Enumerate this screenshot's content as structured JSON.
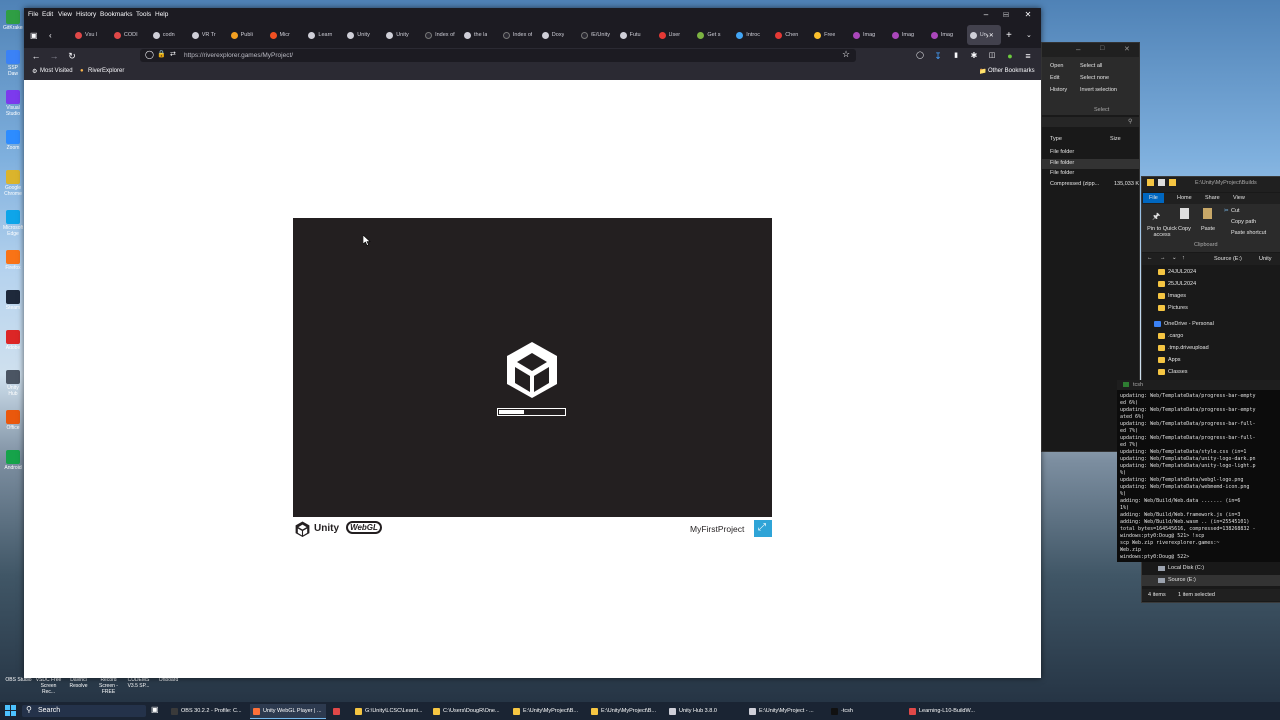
{
  "desktop": {
    "icons": [
      "GitKraken",
      "SSP Daw",
      "Visual Studio",
      "Zoom",
      "Google Chrome",
      "Microsoft Edge",
      "Firefox",
      "Steam",
      "Adobe",
      "Unity Hub",
      "Office",
      "Android"
    ],
    "shortcut_labels": [
      "OBS Studio",
      "VSDC Free Screen Rec...",
      "Davinci Resolve",
      "Record Screen - FREE",
      "CUDEMS V3.5 SP...",
      "Onboard"
    ]
  },
  "browser": {
    "menu": [
      "File",
      "Edit",
      "View",
      "History",
      "Bookmarks",
      "Tools",
      "Help"
    ],
    "tabs": [
      {
        "label": "Vsu l",
        "color": "#e04848"
      },
      {
        "label": "CODI",
        "color": "#e04848"
      },
      {
        "label": "codn",
        "color": "#cfcfd8"
      },
      {
        "label": "VR Tr",
        "color": "#cfcfd8"
      },
      {
        "label": "Publi",
        "color": "#f3a021"
      },
      {
        "label": "Micr",
        "color": "#f25022"
      },
      {
        "label": "Learn",
        "color": "#cfcfd8"
      },
      {
        "label": "Unity",
        "color": "#cfcfd8"
      },
      {
        "label": "Unity",
        "color": "#cfcfd8"
      },
      {
        "label": "Index of",
        "color": "#2b2a33"
      },
      {
        "label": "the la",
        "color": "#cfcfd8"
      },
      {
        "label": "Index of",
        "color": "#2b2a33"
      },
      {
        "label": "Doxy",
        "color": "#cfcfd8"
      },
      {
        "label": "/E/Unity",
        "color": "#2b2a33"
      },
      {
        "label": "Futu",
        "color": "#cfcfd8"
      },
      {
        "label": "User",
        "color": "#e53935"
      },
      {
        "label": "Get s",
        "color": "#7cb342"
      },
      {
        "label": "Introc",
        "color": "#42a5f5"
      },
      {
        "label": "Chen",
        "color": "#e53935"
      },
      {
        "label": "Free",
        "color": "#fbc02d"
      },
      {
        "label": "Imag",
        "color": "#ab47bc"
      },
      {
        "label": "Imag",
        "color": "#ab47bc"
      },
      {
        "label": "Imag",
        "color": "#ab47bc"
      },
      {
        "label": "Un",
        "color": "#cfcfd8",
        "active": true
      }
    ],
    "url": "https://riverexplorer.games/MyProject/",
    "bookmarks": [
      "Most Visited",
      "RiverExplorer"
    ],
    "other_bookmarks": "Other Bookmarks"
  },
  "unity_page": {
    "loading_progress": 0.38,
    "footer_brand_unity": "Unity",
    "footer_brand_webgl": "WebGL",
    "project_title": "MyFirstProject",
    "colors": {
      "canvas_bg": "#231f20",
      "fullscreen_button": "#2fa4d7"
    }
  },
  "explorer_main": {
    "ribbon": [
      "Open",
      "Edit",
      "History",
      "Select all",
      "Select none",
      "Invert selection"
    ],
    "ribbon_group": "Select",
    "columns": [
      "Type",
      "Size"
    ],
    "rows": [
      {
        "type": "File folder",
        "size": ""
      },
      {
        "type": "File folder",
        "size": ""
      },
      {
        "type": "File folder",
        "size": ""
      },
      {
        "type": "Compressed (zipp...",
        "size": "135,033 K"
      }
    ]
  },
  "explorer_builds": {
    "title": "E:\\Unity\\MyProject\\Builds",
    "ribbon_tabs": [
      "File",
      "Home",
      "Share",
      "View"
    ],
    "clipboard_buttons": [
      "Pin to Quick access",
      "Copy",
      "Paste"
    ],
    "clipboard_small": [
      "Cut",
      "Copy path",
      "Paste shortcut"
    ],
    "clipboard_group": "Clipboard",
    "path": [
      "Source (E:)",
      "Unity"
    ],
    "tree": [
      "24JUL2024",
      "25JUL2024",
      "Images",
      "Pictures",
      "OneDrive - Personal",
      ".cargo",
      ".tmp.driveupload",
      "Apps",
      "Classes"
    ],
    "drives": [
      "Local Disk (C:)",
      "Source (E:)"
    ],
    "status": [
      "4 items",
      "1 item selected"
    ]
  },
  "terminal": {
    "title": "tcsh",
    "lines": [
      "updating: Web/TemplateData/progress-bar-empty",
      "ed 6%)",
      "updating: Web/TemplateData/progress-bar-empty",
      "ated 6%)",
      "updating: Web/TemplateData/progress-bar-full-",
      "ed 7%)",
      "updating: Web/TemplateData/progress-bar-full-",
      "ed 7%)",
      "updating: Web/TemplateData/style.css    (in=1",
      "updating: Web/TemplateData/unity-logo-dark.pn",
      "updating: Web/TemplateData/unity-logo-light.p",
      "%)",
      "updating: Web/TemplateData/webgl-logo.png",
      "updating: Web/TemplateData/webmemd-icon.png",
      "%)",
      "  adding: Web/Build/Web.data .......     (in=6",
      "1%)",
      "  adding: Web/Build/Web.framework.js     (in=3",
      "  adding: Web/Build/Web.wasm .. (in=25545101)",
      "total bytes=164545616, compressed=138268832 -",
      "windows:pty0:Doug@ 521> !scp",
      "scp Web.zip riverexplorer.games:~",
      "Web.zip",
      "windows:pty0:Doug@ 522>"
    ]
  },
  "taskbar": {
    "search": "Search",
    "items": [
      {
        "label": "OBS 30.2.2 - Profile: C...",
        "color": "#3a3a3a"
      },
      {
        "label": "Unity WebGL Player | ...",
        "color": "#ff7139",
        "active": true
      },
      {
        "label": "",
        "color": "#e04848"
      },
      {
        "label": "G:\\Unity\\LCSC\\Learni...",
        "color": "#f5c542"
      },
      {
        "label": "C:\\Users\\DougR\\One...",
        "color": "#f5c542"
      },
      {
        "label": "E:\\Unity\\MyProject\\B...",
        "color": "#f5c542"
      },
      {
        "label": "E:\\Unity\\MyProject\\B...",
        "color": "#f5c542"
      },
      {
        "label": "Unity Hub 3.8.0",
        "color": "#cfcfd8"
      },
      {
        "label": "E:\\Unity\\MyProject - ...",
        "color": "#cfcfd8"
      },
      {
        "label": "-tcsh",
        "color": "#111111"
      },
      {
        "label": "Learning-L10-BuildW...",
        "color": "#e04848"
      }
    ]
  }
}
